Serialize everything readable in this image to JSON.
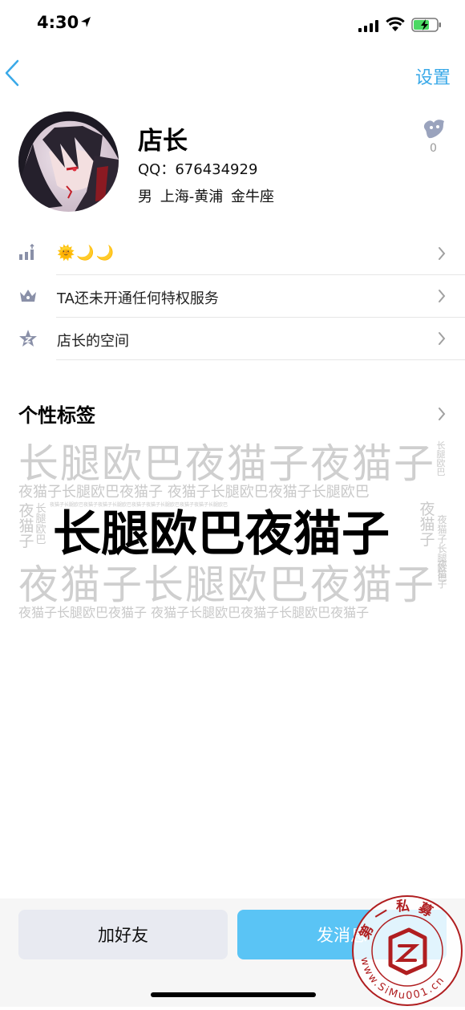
{
  "status_bar": {
    "time": "4:30"
  },
  "nav": {
    "settings": "设置"
  },
  "profile": {
    "name": "店长",
    "qq_label": "QQ：",
    "qq_number": "676434929",
    "gender": "男",
    "location": "上海-黄浦",
    "zodiac": "金牛座",
    "like_count": "0"
  },
  "rows": {
    "level_emoji": "🌞🌙🌙",
    "privilege": "TA还未开通任何特权服务",
    "space": "店长的空间"
  },
  "tags": {
    "title": "个性标签",
    "cloud": {
      "row1": "长腿欧巴夜猫子夜猫子",
      "row2": "夜猫子长腿欧巴夜猫子 夜猫子长腿欧巴夜猫子长腿欧巴",
      "row3_small": "夜猫子长腿欧巴夜猫子夜猫子长腿欧巴夜猫子夜猫子长腿欧巴夜猫子夜猫子长腿欧巴",
      "main": "长腿欧巴夜猫子",
      "row5": "夜猫子长腿欧巴夜猫子",
      "row6": "夜猫子长腿欧巴夜猫子 夜猫子长腿欧巴夜猫子长腿欧巴夜猫子",
      "left_col1": "夜猫子",
      "left_col2": "长腿欧巴",
      "right_col1": "长腿欧巴",
      "right_col2": "夜猫子",
      "right_col3": "夜猫子长腿欧巴",
      "right_col4": "夜猫子"
    }
  },
  "actions": {
    "add_friend": "加好友",
    "send_message": "发消息"
  },
  "watermark": {
    "top": "第一私募",
    "bottom": "www.SiMu001.cn"
  },
  "colors": {
    "accent": "#3aa9e8",
    "primary_button": "#5ac4f5",
    "secondary_button": "#e8eaf1",
    "icon_gray": "#8a90a8"
  }
}
